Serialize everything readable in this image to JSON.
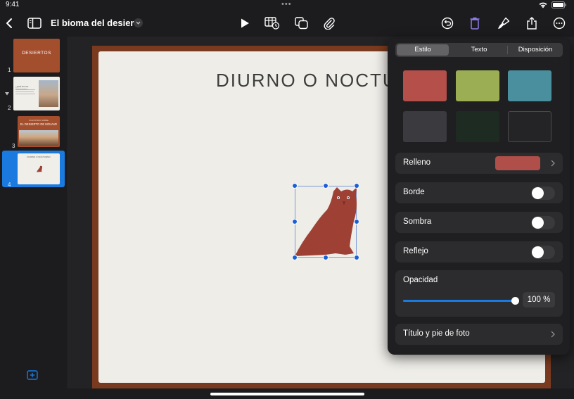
{
  "status": {
    "time": "9:41",
    "dots": "•••"
  },
  "toolbar": {
    "doc_title": "El bioma del desierto"
  },
  "slides": [
    {
      "num": "1",
      "title": "DESIERTOS"
    },
    {
      "num": "2",
      "title": "¿QUÉ ES UN DESIERTO?"
    },
    {
      "num": "3",
      "subtitle": "UN ESTUDIO SOBRE",
      "title": "EL DESIERTO DE MOJAVE"
    },
    {
      "num": "4",
      "title": "DIURNO O NOCTURNO"
    }
  ],
  "current_slide": {
    "title": "DIURNO O NOCTU"
  },
  "panel": {
    "tabs": [
      "Estilo",
      "Texto",
      "Disposición"
    ],
    "active_tab": "Estilo",
    "swatches": [
      "#b44f4a",
      "#9bae54",
      "#4a8f9e",
      "#3b3b3f",
      "#1e2b22",
      "#242426"
    ],
    "fill": {
      "label": "Relleno",
      "color": "#b04f4a"
    },
    "border": {
      "label": "Borde"
    },
    "shadow": {
      "label": "Sombra"
    },
    "reflection": {
      "label": "Reflejo"
    },
    "opacity": {
      "label": "Opacidad",
      "value": "100 %",
      "level": 1.0
    },
    "caption": {
      "label": "Título y pie de foto"
    }
  },
  "colors": {
    "accent": "#1a7ae0",
    "owl": "#9e4134",
    "panel_bg": "#1f1f21"
  }
}
